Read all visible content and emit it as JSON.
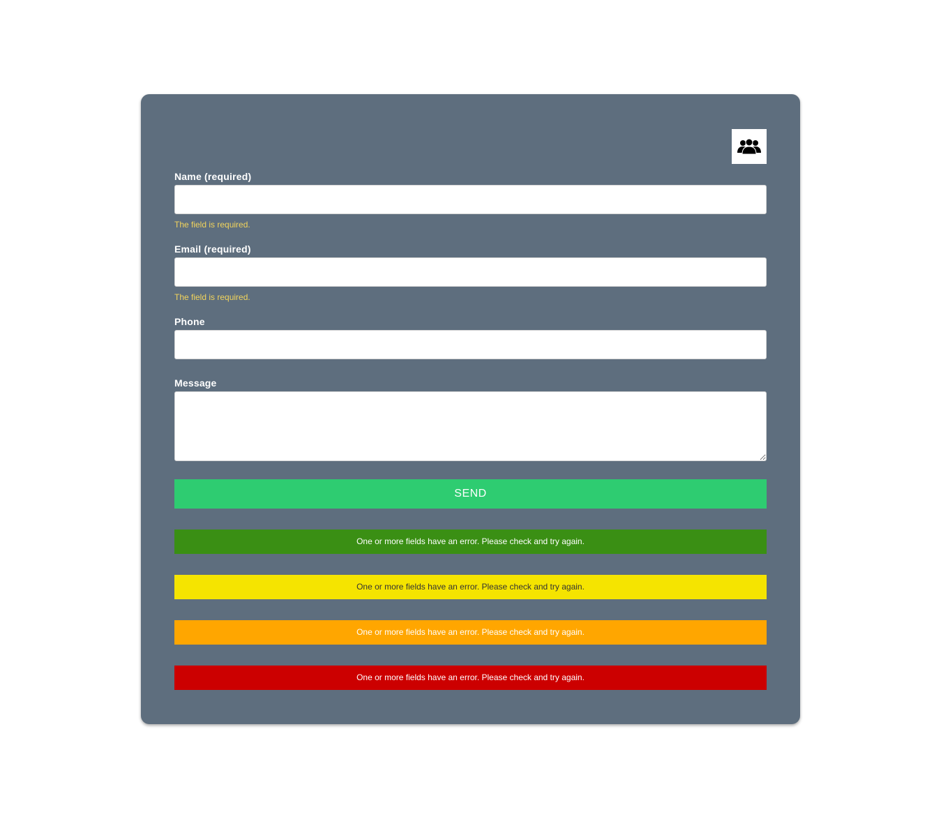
{
  "form": {
    "team_icon": "team-icon",
    "fields": {
      "name": {
        "label": "Name (required)",
        "error": "The field is required.",
        "value": ""
      },
      "email": {
        "label": "Email (required)",
        "error": "The field is required.",
        "value": ""
      },
      "phone": {
        "label": "Phone",
        "value": ""
      },
      "message": {
        "label": "Message",
        "value": ""
      }
    },
    "send_label": "SEND"
  },
  "alerts": [
    {
      "text": "One or more fields have an error. Please check and try again.",
      "background": "#3a8f14",
      "color": "#ffffff"
    },
    {
      "text": "One or more fields have an error. Please check and try again.",
      "background": "#f5e400",
      "color": "#333333"
    },
    {
      "text": "One or more fields have an error. Please check and try again.",
      "background": "#ffa600",
      "color": "#ffffff"
    },
    {
      "text": "One or more fields have an error. Please check and try again.",
      "background": "#cc0000",
      "color": "#ffffff"
    }
  ],
  "colors": {
    "card_background": "#5e6e7e",
    "send_button": "#2ecc71",
    "error_text": "#f2d45c"
  }
}
